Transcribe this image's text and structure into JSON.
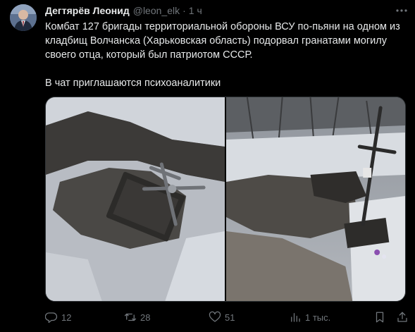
{
  "author": {
    "name": "Дегтярёв Леонид",
    "handle": "@leon_elk",
    "separator": "·",
    "time": "1 ч",
    "avatar_icon": "avatar-photo"
  },
  "tweet": {
    "text": "Комбат 127 бригады территориальной обороны ВСУ по-пьяни на одном из кладбищ Волчанска (Харьковская область) подорвал гранатами могилу своего отца, который был патриотом СССР.\n\nВ чат приглашаются психоаналитики"
  },
  "actions": {
    "replies": "12",
    "retweets": "28",
    "likes": "51",
    "views": "1 тыс."
  },
  "icons": {
    "more": "more-icon",
    "reply": "reply-icon",
    "retweet": "retweet-icon",
    "like": "heart-icon",
    "views": "views-icon",
    "bookmark": "bookmark-icon",
    "share": "share-icon"
  },
  "colors": {
    "background": "#000000",
    "text": "#e7e9ea",
    "muted": "#71767b",
    "border": "#2f3336"
  }
}
